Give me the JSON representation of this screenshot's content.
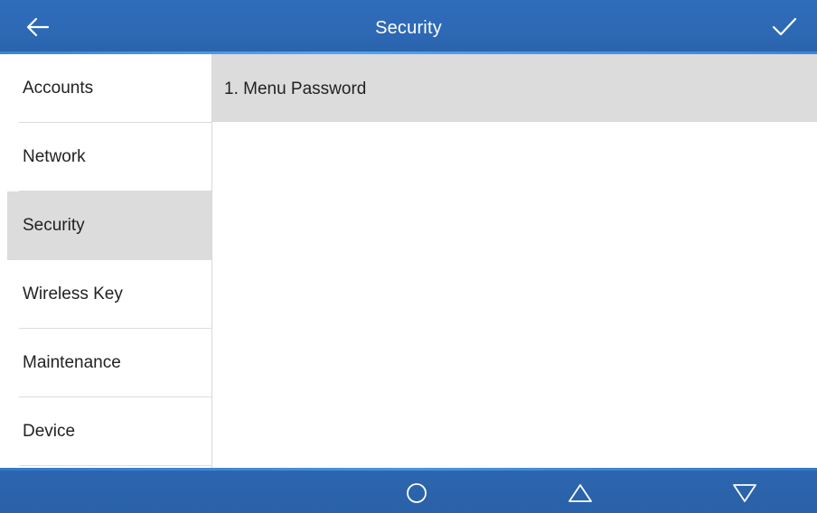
{
  "header": {
    "title": "Security",
    "back_icon": "arrow-left-icon",
    "confirm_icon": "checkmark-icon"
  },
  "sidebar": {
    "items": [
      {
        "label": "Accounts",
        "active": false
      },
      {
        "label": "Network",
        "active": false
      },
      {
        "label": "Security",
        "active": true
      },
      {
        "label": "Wireless Key",
        "active": false
      },
      {
        "label": "Maintenance",
        "active": false
      },
      {
        "label": "Device",
        "active": false
      }
    ]
  },
  "main": {
    "options": [
      {
        "label": "1. Menu Password"
      }
    ]
  },
  "bottom_nav": {
    "buttons": [
      {
        "icon": "circle-icon"
      },
      {
        "icon": "triangle-up-icon"
      },
      {
        "icon": "triangle-down-icon"
      }
    ]
  },
  "colors": {
    "header_bg": "#2d69b5",
    "accent": "#4a94e0",
    "selected_bg": "#dcdcdc",
    "text": "#222222"
  }
}
